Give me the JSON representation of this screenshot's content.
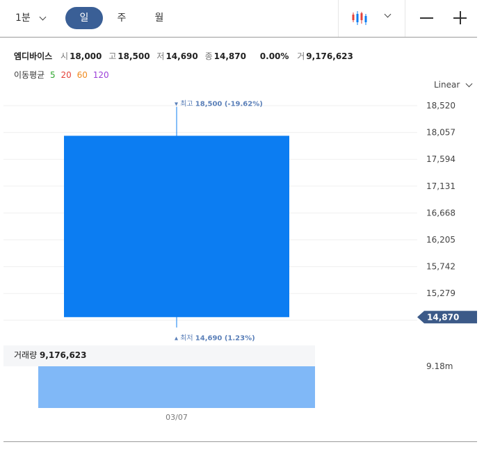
{
  "toolbar": {
    "period_select": "1분",
    "tabs": [
      "일",
      "주",
      "월"
    ],
    "active_tab": "일",
    "chart_type_icon": "candlestick-icon",
    "zoom_out_icon": "minus-icon",
    "zoom_in_icon": "plus-icon"
  },
  "quote": {
    "name": "엠디바이스",
    "open_label": "시",
    "open": "18,000",
    "high_label": "고",
    "high": "18,500",
    "low_label": "저",
    "low": "14,690",
    "close_label": "종",
    "close": "14,870",
    "change": "0.00%",
    "volume_label": "거",
    "volume": "9,176,623"
  },
  "moving_average": {
    "label": "이동평균",
    "periods": [
      {
        "value": "5",
        "color": "#2fa72f"
      },
      {
        "value": "20",
        "color": "#e5423a"
      },
      {
        "value": "60",
        "color": "#f08a1d"
      },
      {
        "value": "120",
        "color": "#9b3fd8"
      }
    ]
  },
  "scale_label": "Linear",
  "chart_data": {
    "type": "candlestick",
    "candles": [
      {
        "date": "03/07",
        "open": 18000,
        "high": 18500,
        "low": 14690,
        "close": 14870
      }
    ],
    "y_ticks": [
      "18,520",
      "18,057",
      "17,594",
      "17,131",
      "16,668",
      "16,205",
      "15,742",
      "15,279"
    ],
    "ylim": [
      14816,
      18520
    ],
    "current_price_label": "14,870",
    "high_annotation": {
      "label": "최고",
      "text": "18,500 (-19.62%)"
    },
    "low_annotation": {
      "label": "최저",
      "text": "14,690 (1.23%)"
    },
    "volume": {
      "label": "거래량",
      "value": 9176623,
      "value_text": "9,176,623",
      "axis_max_label": "9.18m"
    },
    "x_labels": [
      "03/07"
    ],
    "grid": true,
    "colors": {
      "candle": "#0c7df2",
      "volume": "#80b8f7",
      "price_tag": "#3c5a88",
      "annotation": "#5a7fb8"
    }
  }
}
